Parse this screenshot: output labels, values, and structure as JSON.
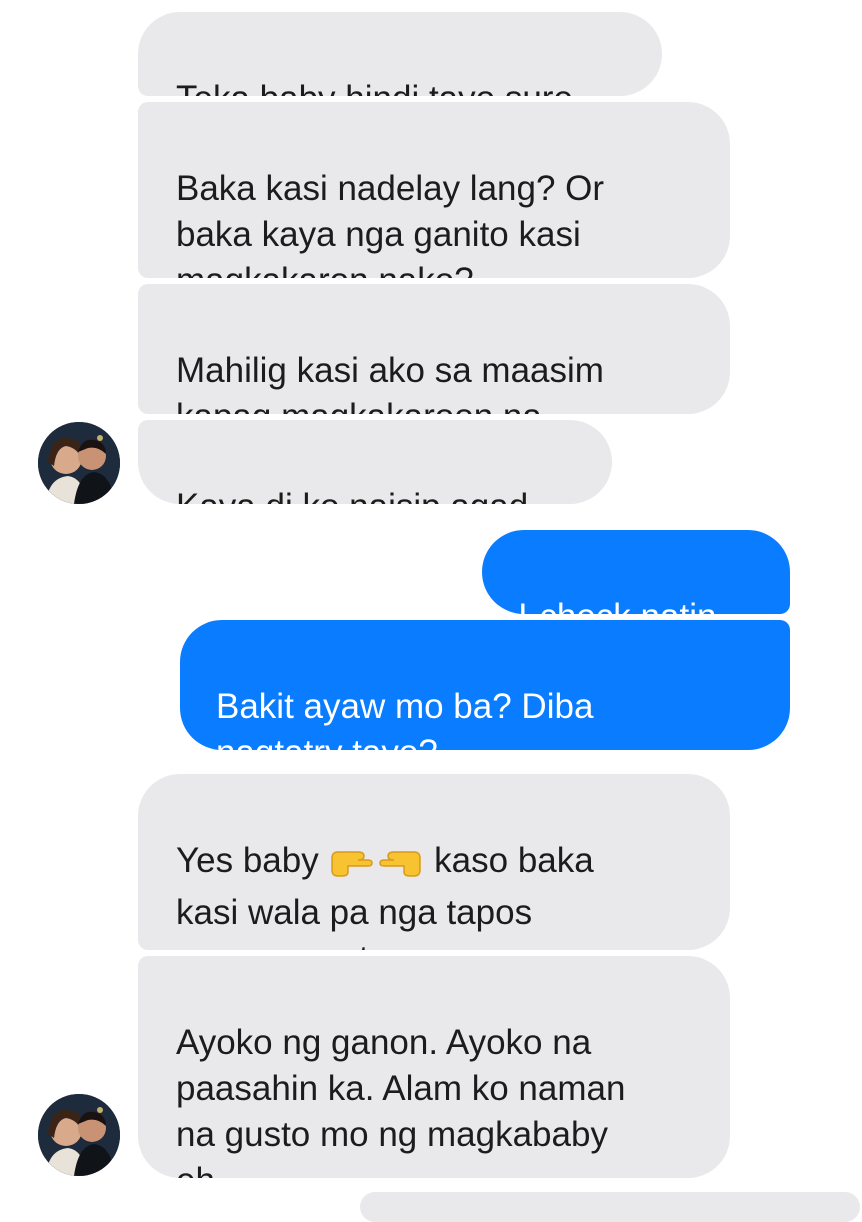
{
  "messages": [
    {
      "id": "m1",
      "side": "incoming",
      "text": "Teka baby hindi tayo sure."
    },
    {
      "id": "m2",
      "side": "incoming",
      "text": "Baka kasi nadelay lang? Or\nbaka kaya nga ganito kasi\nmagkakaron nako?"
    },
    {
      "id": "m3",
      "side": "incoming",
      "text": "Mahilig kasi ako sa maasim\nkapag magkakaroon na."
    },
    {
      "id": "m4",
      "side": "incoming",
      "text": "Kaya di ko naisip agad."
    },
    {
      "id": "m5",
      "side": "outgoing",
      "text": "I-check natin."
    },
    {
      "id": "m6",
      "side": "outgoing",
      "text": "Bakit ayaw mo ba? Diba\nnagtatry tayo?"
    },
    {
      "id": "m7",
      "side": "incoming",
      "text_before_emoji": "Yes baby ",
      "emoji": [
        "backhand-index-pointing-right",
        "backhand-index-pointing-left"
      ],
      "text_after_emoji": " kaso baka\nkasi wala pa nga tapos\numaasa na tayo"
    },
    {
      "id": "m8",
      "side": "incoming",
      "text": "Ayoko ng ganon. Ayoko na\npaasahin ka. Alam ko naman\nna gusto mo ng magkababy\neh."
    }
  ],
  "colors": {
    "incoming_bubble": "#e9e9eb",
    "incoming_text": "#1c1c1c",
    "outgoing_bubble": "#0a7cff",
    "outgoing_text": "#ffffff",
    "emoji_yellow": "#f7c331"
  }
}
